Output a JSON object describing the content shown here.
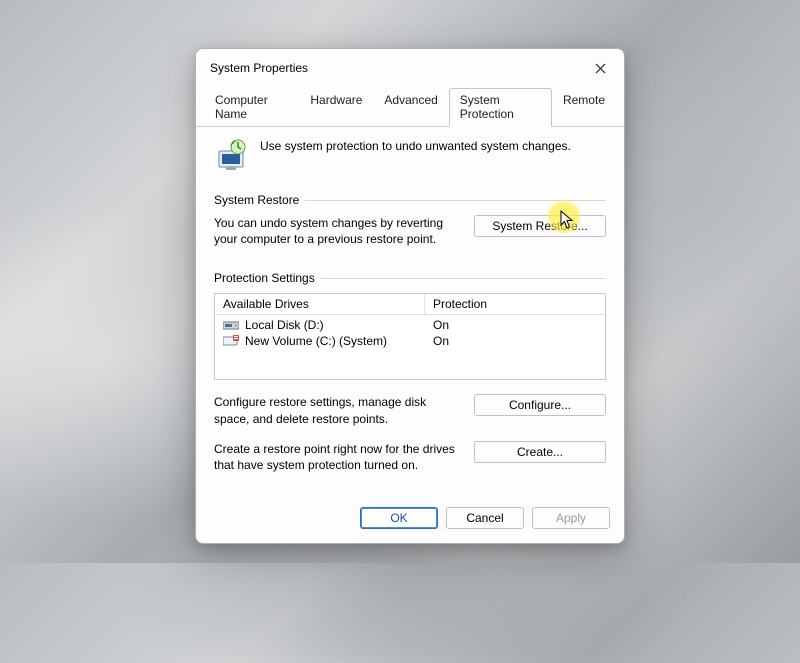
{
  "title": "System Properties",
  "tabs": [
    "Computer Name",
    "Hardware",
    "Advanced",
    "System Protection",
    "Remote"
  ],
  "active_tab_index": 3,
  "intro": "Use system protection to undo unwanted system changes.",
  "restore_group": {
    "legend": "System Restore",
    "text": "You can undo system changes by reverting your computer to a previous restore point.",
    "button": "System Restore..."
  },
  "settings_group": {
    "legend": "Protection Settings",
    "columns": [
      "Available Drives",
      "Protection"
    ],
    "drives": [
      {
        "icon": "hdd-icon",
        "name": "Local Disk (D:)",
        "protection": "On"
      },
      {
        "icon": "hdd-alt-icon",
        "name": "New Volume (C:) (System)",
        "protection": "On"
      }
    ],
    "configure": {
      "text": "Configure restore settings, manage disk space, and delete restore points.",
      "button": "Configure..."
    },
    "create": {
      "text": "Create a restore point right now for the drives that have system protection turned on.",
      "button": "Create..."
    }
  },
  "footer": {
    "ok": "OK",
    "cancel": "Cancel",
    "apply": "Apply"
  }
}
